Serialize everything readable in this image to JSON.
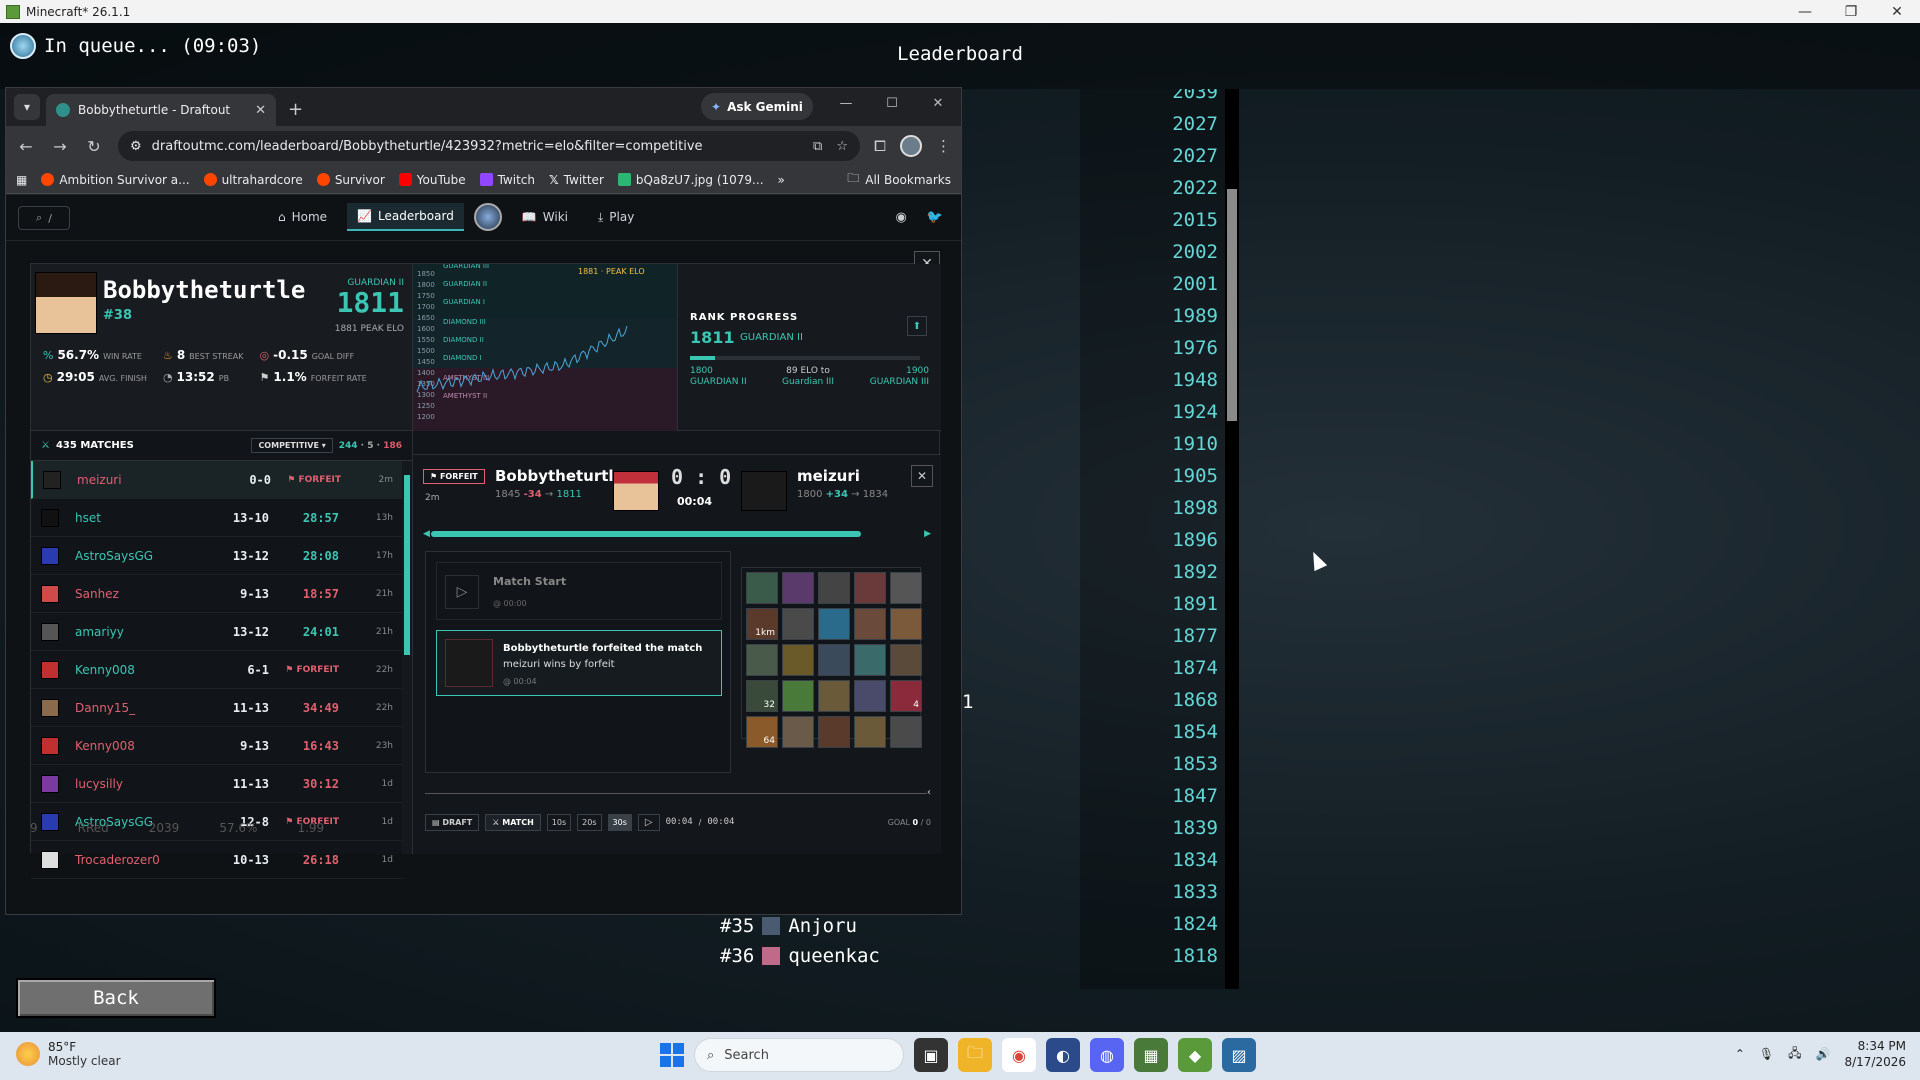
{
  "window": {
    "title": "Minecraft* 26.1.1"
  },
  "game": {
    "queue": "In queue... (09:03)",
    "screen_title": "Leaderboard",
    "back_label": "Back",
    "partial_value": "1",
    "scores": [
      "2039",
      "2027",
      "2027",
      "2022",
      "2015",
      "2002",
      "2001",
      "1989",
      "1976",
      "1948",
      "1924",
      "1910",
      "1905",
      "1898",
      "1896",
      "1892",
      "1891",
      "1877",
      "1874",
      "1868",
      "1854",
      "1853",
      "1847",
      "1839",
      "1834",
      "1833",
      "1824",
      "1818"
    ],
    "rows": [
      {
        "rank": "#35",
        "name": "Anjoru"
      },
      {
        "rank": "#36",
        "name": "queenkac"
      }
    ]
  },
  "browser": {
    "tab_title": "Bobbytheturtle - Draftout",
    "gemini": "Ask Gemini",
    "url": "draftoutmc.com/leaderboard/Bobbytheturtle/423932?metric=elo&filter=competitive",
    "bookmarks": [
      "Ambition Survivor a...",
      "ultrahardcore",
      "Survivor",
      "YouTube",
      "Twitch",
      "Twitter",
      "bQa8zU7.jpg (1079..."
    ],
    "all_bookmarks": "All Bookmarks"
  },
  "site": {
    "search_hint": "/",
    "nav": [
      "Home",
      "Leaderboard",
      "Wiki",
      "Play"
    ]
  },
  "profile": {
    "name": "Bobbytheturtle",
    "rank": "#38",
    "tier": "GUARDIAN II",
    "elo": "1811",
    "peak": "1881 PEAK ELO",
    "win_rate": "56.7%",
    "win_rate_label": "WIN RATE",
    "best_streak": "8",
    "best_streak_label": "BEST STREAK",
    "goal_diff": "-0.15",
    "goal_diff_label": "GOAL DIFF",
    "avg_finish": "29:05",
    "avg_finish_label": "AVG. FINISH",
    "pb": "13:52",
    "pb_label": "PB",
    "forfeit_rate": "1.1%",
    "forfeit_rate_label": "FORFEIT RATE"
  },
  "chart": {
    "peak_label": "1881 · PEAK ELO",
    "ylabels": [
      "1850",
      "1800",
      "1750",
      "1700",
      "1650",
      "1600",
      "1550",
      "1500",
      "1450",
      "1400",
      "1350",
      "1300",
      "1250",
      "1200"
    ],
    "tiers": [
      "GUARDIAN III",
      "GUARDIAN II",
      "GUARDIAN I",
      "DIAMOND III",
      "DIAMOND II",
      "DIAMOND I",
      "AMETHYST III",
      "AMETHYST II"
    ]
  },
  "rank_progress": {
    "title": "RANK PROGRESS",
    "elo": "1811",
    "tier": "GUARDIAN II",
    "progress": 0.11,
    "left_value": "1800",
    "left_tier": "GUARDIAN II",
    "mid_top": "89 ELO to",
    "mid_bottom": "Guardian III",
    "right_value": "1900",
    "right_tier": "GUARDIAN III"
  },
  "matches": {
    "count_label": "435 MATCHES",
    "filter": "COMPETITIVE",
    "wins": "244",
    "draws": "5",
    "losses": "186",
    "rows": [
      {
        "name": "meizuri",
        "score": "0-0",
        "time": "",
        "ff": "FORFEIT",
        "ago": "2m",
        "res": "lose",
        "sel": true,
        "color": "#222"
      },
      {
        "name": "hset",
        "score": "13-10",
        "time": "28:57",
        "ff": "",
        "ago": "13h",
        "res": "win",
        "sel": false,
        "color": "#111"
      },
      {
        "name": "AstroSaysGG",
        "score": "13-12",
        "time": "28:08",
        "ff": "",
        "ago": "17h",
        "res": "win",
        "sel": false,
        "color": "#2a3ab0"
      },
      {
        "name": "Sanhez",
        "score": "9-13",
        "time": "18:57",
        "ff": "",
        "ago": "21h",
        "res": "lose",
        "sel": false,
        "color": "#d04a4a"
      },
      {
        "name": "amariyy",
        "score": "13-12",
        "time": "24:01",
        "ff": "",
        "ago": "21h",
        "res": "win",
        "sel": false,
        "color": "#555"
      },
      {
        "name": "Kenny008",
        "score": "6-1",
        "time": "",
        "ff": "FORFEIT",
        "ago": "22h",
        "res": "win",
        "sel": false,
        "color": "#c03030"
      },
      {
        "name": "Danny15_",
        "score": "11-13",
        "time": "34:49",
        "ff": "",
        "ago": "22h",
        "res": "lose",
        "sel": false,
        "color": "#8a6a4a"
      },
      {
        "name": "Kenny008",
        "score": "9-13",
        "time": "16:43",
        "ff": "",
        "ago": "23h",
        "res": "lose",
        "sel": false,
        "color": "#c03030"
      },
      {
        "name": "lucysilly",
        "score": "11-13",
        "time": "30:12",
        "ff": "",
        "ago": "1d",
        "res": "lose",
        "sel": false,
        "color": "#7a3aa0"
      },
      {
        "name": "AstroSaysGG",
        "score": "12-8",
        "time": "",
        "ff": "FORFEIT",
        "ago": "1d",
        "res": "win",
        "sel": false,
        "color": "#2a3ab0"
      },
      {
        "name": "Trocaderozer0",
        "score": "10-13",
        "time": "26:18",
        "ff": "",
        "ago": "1d",
        "res": "lose",
        "sel": false,
        "color": "#ddd"
      }
    ],
    "peek": {
      "rank": "9",
      "name": "RRed",
      "elo": "2039",
      "rate": "57.6%",
      "gd": "1.99"
    }
  },
  "detail": {
    "badge": "FORFEIT",
    "ago": "2m",
    "p1": "Bobbytheturtle",
    "p1_from": "1845",
    "p1_delta": "-34",
    "p1_to": "1811",
    "p2": "meizuri",
    "p2_from": "1800",
    "p2_delta": "+34",
    "p2_to": "1834",
    "score": "0 : 0",
    "time": "00:04",
    "ev1_title": "Match Start",
    "ev1_time": "@ 00:00",
    "ev2_line1": "Bobbytheturtle forfeited the match",
    "ev2_line2": "meizuri wins by forfeit",
    "ev2_time": "@ 00:04",
    "grid_quantities": [
      "1km",
      "32",
      "64",
      "4"
    ],
    "mode_draft": "DRAFT",
    "mode_match": "MATCH",
    "speeds": [
      "10s",
      "20s",
      "30s"
    ],
    "cur_time": "00:04",
    "total_time": "00:04",
    "goal_label": "GOAL",
    "goal_a": "0",
    "goal_b": "0"
  },
  "taskbar": {
    "temp": "85°F",
    "weather": "Mostly clear",
    "search": "Search",
    "time": "8:34 PM",
    "date": "8/17/2026"
  }
}
